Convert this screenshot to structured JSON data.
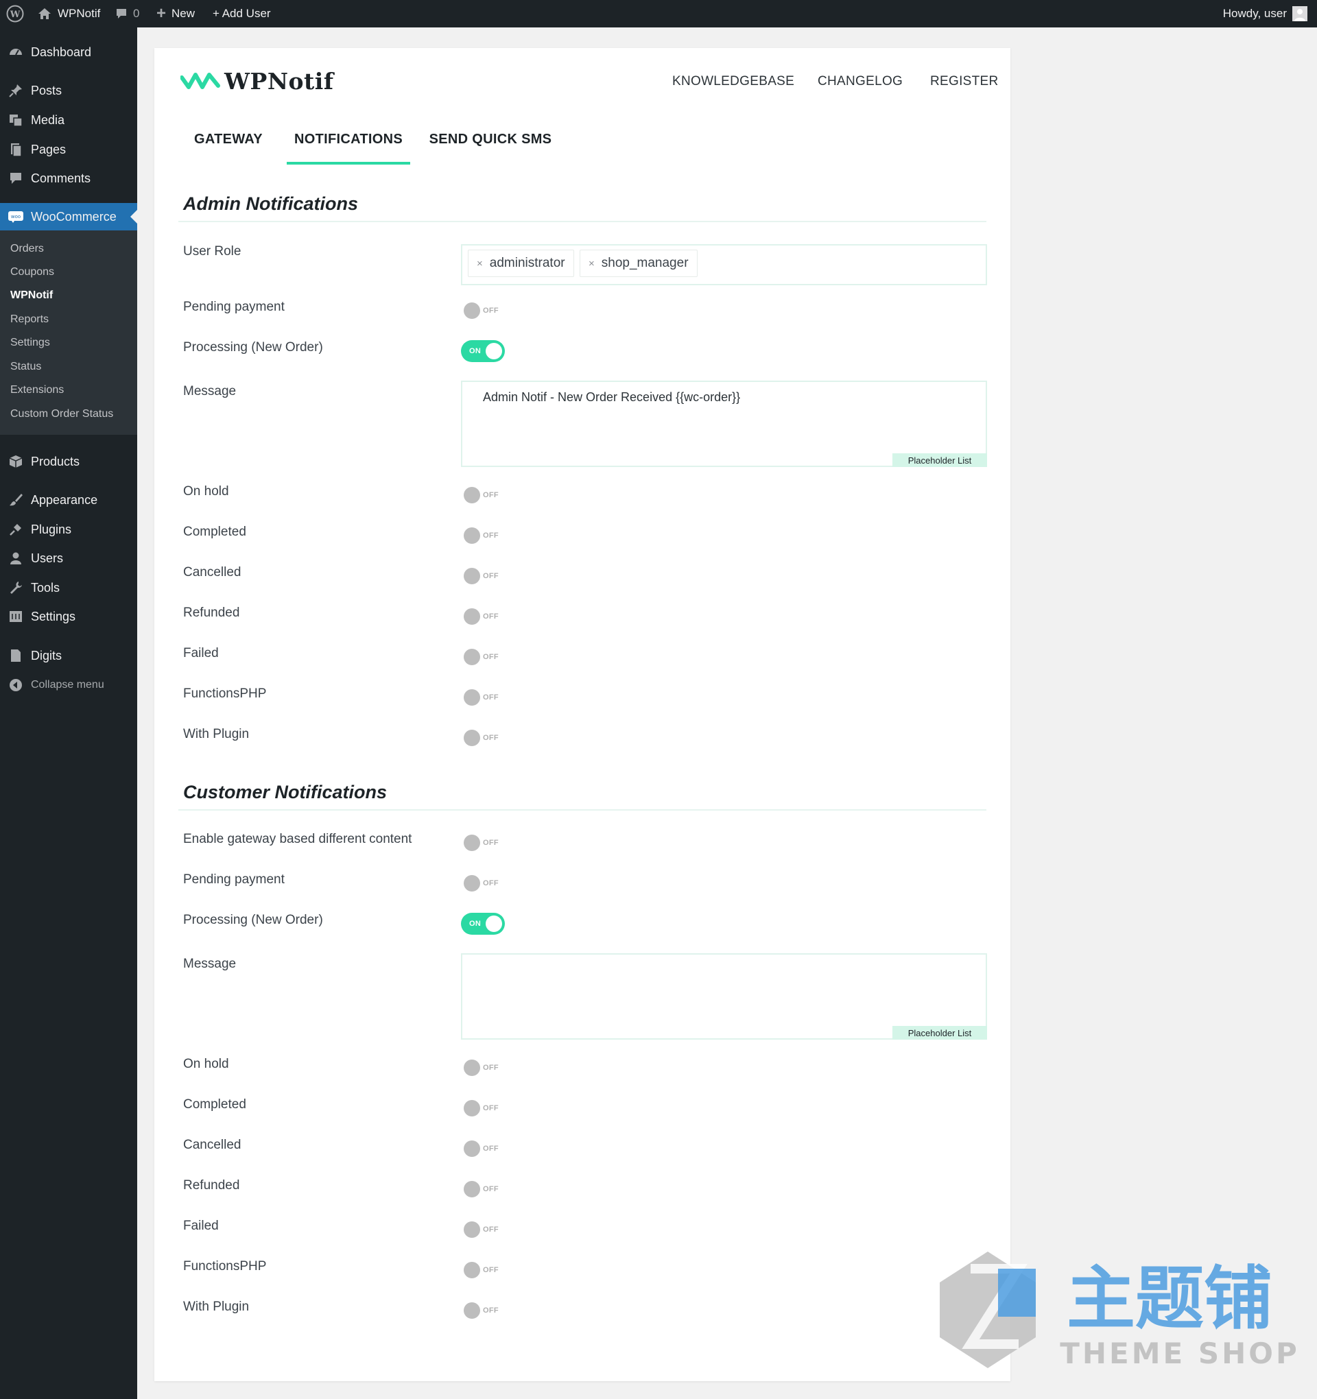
{
  "admin_bar": {
    "site_name": "WPNotif",
    "comments_count": "0",
    "new_label": "New",
    "add_user_label": "+ Add User",
    "howdy": "Howdy, user"
  },
  "sidebar": {
    "items": [
      {
        "label": "Dashboard",
        "icon": "dashboard-icon"
      },
      {
        "label": "Posts",
        "icon": "pin-icon"
      },
      {
        "label": "Media",
        "icon": "media-icon"
      },
      {
        "label": "Pages",
        "icon": "pages-icon"
      },
      {
        "label": "Comments",
        "icon": "comment-icon"
      },
      {
        "label": "WooCommerce",
        "icon": "woo-icon"
      },
      {
        "label": "Products",
        "icon": "box-icon"
      },
      {
        "label": "Appearance",
        "icon": "brush-icon"
      },
      {
        "label": "Plugins",
        "icon": "plug-icon"
      },
      {
        "label": "Users",
        "icon": "user-icon"
      },
      {
        "label": "Tools",
        "icon": "wrench-icon"
      },
      {
        "label": "Settings",
        "icon": "settings-icon"
      },
      {
        "label": "Digits",
        "icon": "digits-icon"
      },
      {
        "label": "Collapse menu",
        "icon": "collapse-icon"
      }
    ],
    "submenu": [
      "Orders",
      "Coupons",
      "WPNotif",
      "Reports",
      "Settings",
      "Status",
      "Extensions",
      "Custom Order Status"
    ],
    "accent": "#2271b1"
  },
  "header": {
    "logo_text": "WPNotif",
    "links": [
      "KNOWLEDGEBASE",
      "CHANGELOG",
      "REGISTER"
    ],
    "tabs": [
      "GATEWAY",
      "NOTIFICATIONS",
      "SEND QUICK SMS"
    ],
    "active_tab": "NOTIFICATIONS",
    "accent": "#2bd9a3"
  },
  "admin_notifications": {
    "title": "Admin Notifications",
    "user_role_label": "User Role",
    "roles": [
      "administrator",
      "shop_manager"
    ],
    "remove_symbol": "×",
    "pending_payment": {
      "label": "Pending payment",
      "state": "OFF"
    },
    "processing": {
      "label": "Processing (New Order)",
      "state": "ON"
    },
    "message_label": "Message",
    "message_value": "Admin Notif - New Order Received {{wc-order}}",
    "placeholder_list": "Placeholder List",
    "statuses": [
      {
        "label": "On hold",
        "state": "OFF"
      },
      {
        "label": "Completed",
        "state": "OFF"
      },
      {
        "label": "Cancelled",
        "state": "OFF"
      },
      {
        "label": "Refunded",
        "state": "OFF"
      },
      {
        "label": "Failed",
        "state": "OFF"
      },
      {
        "label": "FunctionsPHP",
        "state": "OFF"
      },
      {
        "label": "With Plugin",
        "state": "OFF"
      }
    ]
  },
  "customer_notifications": {
    "title": "Customer Notifications",
    "gateway_content": {
      "label": "Enable gateway based different content",
      "state": "OFF"
    },
    "pending_payment": {
      "label": "Pending payment",
      "state": "OFF"
    },
    "processing": {
      "label": "Processing (New Order)",
      "state": "ON"
    },
    "message_label": "Message",
    "message_value": "",
    "placeholder_list": "Placeholder List",
    "statuses": [
      {
        "label": "On hold",
        "state": "OFF"
      },
      {
        "label": "Completed",
        "state": "OFF"
      },
      {
        "label": "Cancelled",
        "state": "OFF"
      },
      {
        "label": "Refunded",
        "state": "OFF"
      },
      {
        "label": "Failed",
        "state": "OFF"
      },
      {
        "label": "FunctionsPHP",
        "state": "OFF"
      },
      {
        "label": "With Plugin",
        "state": "OFF"
      }
    ]
  },
  "watermark": {
    "text_cn": "主题铺",
    "text_en": "THEME SHOP"
  }
}
